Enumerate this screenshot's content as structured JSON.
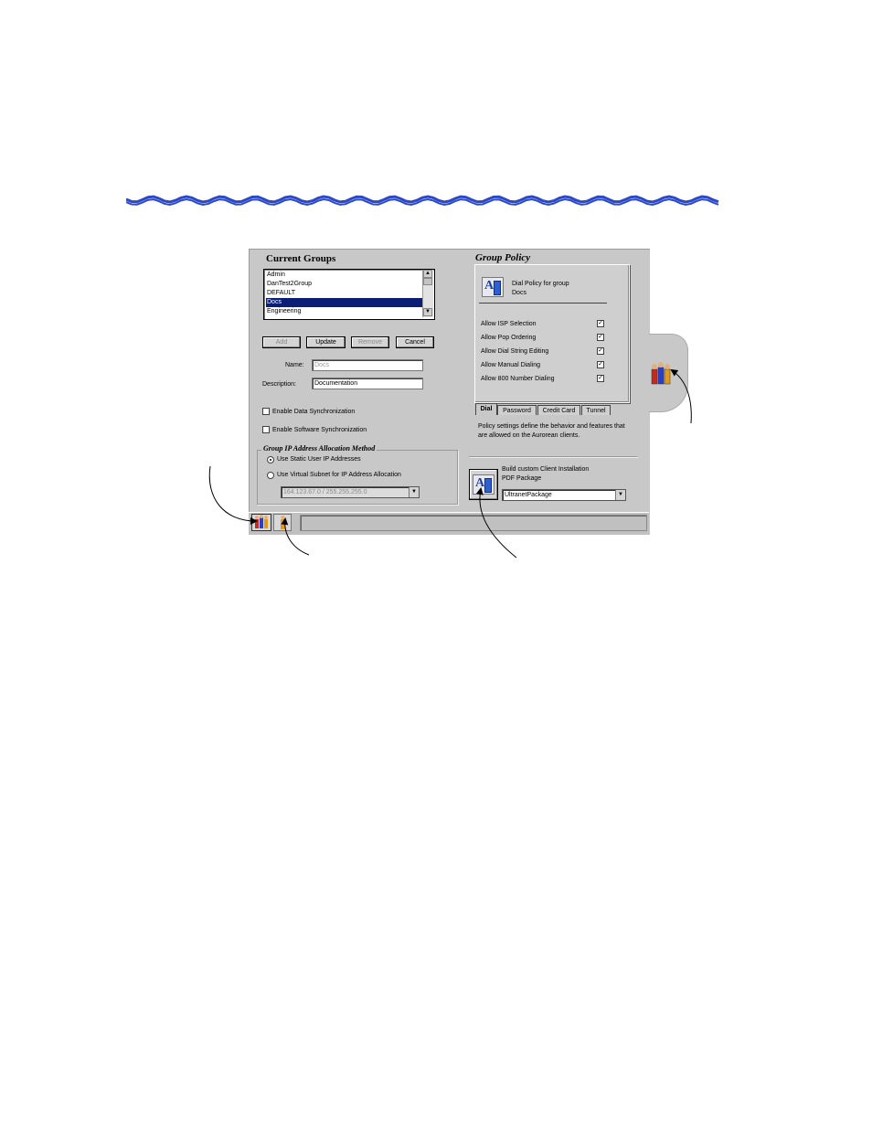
{
  "current_groups": {
    "title": "Current Groups",
    "items": [
      "Admin",
      "DanTest2Group",
      "DEFAULT",
      "Docs",
      "Engineering"
    ],
    "selected": "Docs"
  },
  "buttons": {
    "add": "Add",
    "update": "Update",
    "remove": "Remove",
    "cancel": "Cancel"
  },
  "form": {
    "name_label": "Name:",
    "name_value": "Docs",
    "description_label": "Description:",
    "description_value": "Documentation",
    "enable_data_sync": "Enable Data Synchronization",
    "enable_software_sync": "Enable Software Synchronization"
  },
  "ip_allocation": {
    "title": "Group IP Address Allocation Method",
    "option_static": "Use Static User IP Addresses",
    "option_virtual": "Use Virtual Subnet for IP Address Allocation",
    "subnet_value": "164.123.67.0 / 255.255.255.0"
  },
  "group_policy": {
    "title": "Group Policy",
    "header_line1": "Dial Policy for group",
    "header_line2": "Docs",
    "options": [
      {
        "label": "Allow ISP Selection",
        "checked": true
      },
      {
        "label": "Allow Pop Ordering",
        "checked": true
      },
      {
        "label": "Allow Dial String Editing",
        "checked": true
      },
      {
        "label": "Allow Manual Dialing",
        "checked": true
      },
      {
        "label": "Allow 800 Number Dialing",
        "checked": true
      }
    ],
    "tabs": [
      "Dial",
      "Password",
      "Credit Card",
      "Tunnel"
    ],
    "active_tab": "Dial",
    "description": "Policy settings define the behavior and features that are allowed on the Aurorean clients."
  },
  "build_package": {
    "line1": "Build custom Client Installation",
    "line2": "PDF Package",
    "selected": "UltranetPackage"
  },
  "colors": {
    "selection": "#0a1e78",
    "window_bg": "#c8c8c8",
    "wave": "#2a48c8"
  }
}
